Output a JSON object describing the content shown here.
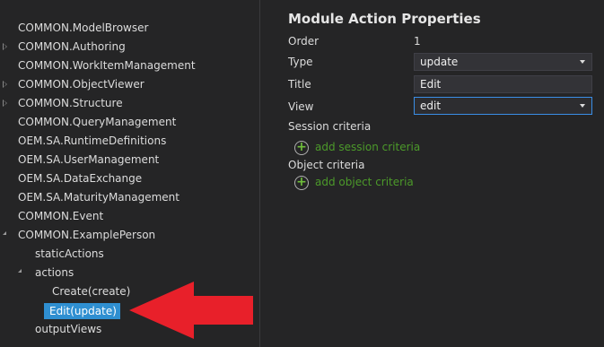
{
  "tree": {
    "items": [
      {
        "label": "COMMON.ModelBrowser",
        "expander": "none"
      },
      {
        "label": "COMMON.Authoring",
        "expander": "collapsed"
      },
      {
        "label": "COMMON.WorkItemManagement",
        "expander": "none"
      },
      {
        "label": "COMMON.ObjectViewer",
        "expander": "collapsed"
      },
      {
        "label": "COMMON.Structure",
        "expander": "collapsed"
      },
      {
        "label": "COMMON.QueryManagement",
        "expander": "none"
      },
      {
        "label": "OEM.SA.RuntimeDefinitions",
        "expander": "none"
      },
      {
        "label": "OEM.SA.UserManagement",
        "expander": "none"
      },
      {
        "label": "OEM.SA.DataExchange",
        "expander": "none"
      },
      {
        "label": "OEM.SA.MaturityManagement",
        "expander": "none"
      },
      {
        "label": "COMMON.Event",
        "expander": "none"
      },
      {
        "label": "COMMON.ExamplePerson",
        "expander": "expanded"
      },
      {
        "label": "staticActions",
        "expander": "none"
      },
      {
        "label": "actions",
        "expander": "expanded"
      },
      {
        "label": "Create(create)",
        "expander": "none"
      },
      {
        "label": "Edit(update)",
        "expander": "none",
        "selected": true
      },
      {
        "label": "outputViews",
        "expander": "none"
      }
    ]
  },
  "properties": {
    "title": "Module Action Properties",
    "order_label": "Order",
    "order_value": "1",
    "type_label": "Type",
    "type_value": "update",
    "title_label": "Title",
    "title_value": "Edit",
    "view_label": "View",
    "view_value": "edit",
    "session_criteria_label": "Session criteria",
    "add_session_criteria": "add session criteria",
    "object_criteria_label": "Object criteria",
    "add_object_criteria": "add object criteria"
  },
  "annotation": {
    "arrow_color": "#e8202a"
  },
  "colors": {
    "selection": "#2f8fd1",
    "link_green": "#4c9a2a",
    "background": "#252526"
  }
}
